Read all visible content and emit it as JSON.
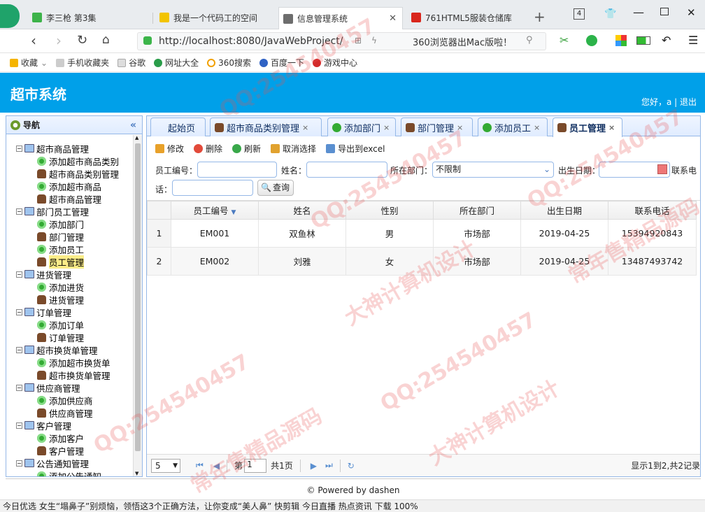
{
  "browser": {
    "tabs": [
      {
        "title": "李三枪 第3集",
        "color": "#3db34a"
      },
      {
        "title": "我是一个代码工的空间",
        "color": "#f2c400"
      },
      {
        "title": "信息管理系统",
        "color": "#6d6d6d",
        "active": true
      },
      {
        "title": "761HTML5服装仓储库",
        "color": "#d9261c"
      }
    ],
    "tab_count": "4",
    "new_tab": "+",
    "url": "http://localhost:8080/JavaWebProject/",
    "search_hint": "360浏览器出Mac版啦！",
    "bookmarks": [
      "收藏",
      "手机收藏夹",
      "谷歌",
      "网址大全",
      "360搜索",
      "百度一下",
      "游戏中心"
    ]
  },
  "app": {
    "title": "超市系统",
    "user_text": "您好，a | 退出"
  },
  "nav": {
    "title": "导航",
    "groups": [
      {
        "label": "超市商品管理",
        "items": [
          {
            "label": "添加超市商品类别",
            "type": "add"
          },
          {
            "label": "超市商品类别管理",
            "type": "user"
          },
          {
            "label": "添加超市商品",
            "type": "add"
          },
          {
            "label": "超市商品管理",
            "type": "user"
          }
        ]
      },
      {
        "label": "部门员工管理",
        "items": [
          {
            "label": "添加部门",
            "type": "add"
          },
          {
            "label": "部门管理",
            "type": "user"
          },
          {
            "label": "添加员工",
            "type": "add"
          },
          {
            "label": "员工管理",
            "type": "user",
            "selected": true
          }
        ]
      },
      {
        "label": "进货管理",
        "items": [
          {
            "label": "添加进货",
            "type": "add"
          },
          {
            "label": "进货管理",
            "type": "user"
          }
        ]
      },
      {
        "label": "订单管理",
        "items": [
          {
            "label": "添加订单",
            "type": "add"
          },
          {
            "label": "订单管理",
            "type": "user"
          }
        ]
      },
      {
        "label": "超市换货单管理",
        "items": [
          {
            "label": "添加超市换货单",
            "type": "add"
          },
          {
            "label": "超市换货单管理",
            "type": "user"
          }
        ]
      },
      {
        "label": "供应商管理",
        "items": [
          {
            "label": "添加供应商",
            "type": "add"
          },
          {
            "label": "供应商管理",
            "type": "user"
          }
        ]
      },
      {
        "label": "客户管理",
        "items": [
          {
            "label": "添加客户",
            "type": "add"
          },
          {
            "label": "客户管理",
            "type": "user"
          }
        ]
      },
      {
        "label": "公告通知管理",
        "items": [
          {
            "label": "添加公告通知",
            "type": "add"
          }
        ]
      }
    ]
  },
  "tabs": [
    {
      "label": "起始页",
      "closable": false
    },
    {
      "label": "超市商品类别管理",
      "closable": true
    },
    {
      "label": "添加部门",
      "closable": true
    },
    {
      "label": "部门管理",
      "closable": true
    },
    {
      "label": "添加员工",
      "closable": true
    },
    {
      "label": "员工管理",
      "closable": true,
      "active": true
    }
  ],
  "toolbar": [
    "修改",
    "删除",
    "刷新",
    "取消选择",
    "导出到excel"
  ],
  "search": {
    "emp_no_label": "员工编号：",
    "name_label": "姓名：",
    "dept_label": "所在部门：",
    "dept_value": "不限制",
    "birth_label": "出生日期：",
    "phone_label": "联系电",
    "phone_label2": "话：",
    "query_button": "查询"
  },
  "grid": {
    "columns": [
      "员工编号",
      "姓名",
      "性别",
      "所在部门",
      "出生日期",
      "联系电话"
    ],
    "rows": [
      [
        "1",
        "EM001",
        "双鱼林",
        "男",
        "市场部",
        "2019-04-25",
        "15394920843"
      ],
      [
        "2",
        "EM002",
        "刘雅",
        "女",
        "市场部",
        "2019-04-25",
        "13487493742"
      ]
    ]
  },
  "pager": {
    "page_size": "5",
    "page_prefix": "第",
    "page_value": "1",
    "page_total": "共1页",
    "summary": "显示1到2,共2记录"
  },
  "footer": "© Powered by dashen",
  "statusbar": "今日优选   女生“塌鼻子”别烦恼，领悟这3个正确方法，让你变成“美人鼻”   快剪辑   今日直播   热点资讯   下载   100%",
  "watermarks": [
    "QQ:254540457",
    "大神计算机设计",
    "常年售精品源码"
  ]
}
